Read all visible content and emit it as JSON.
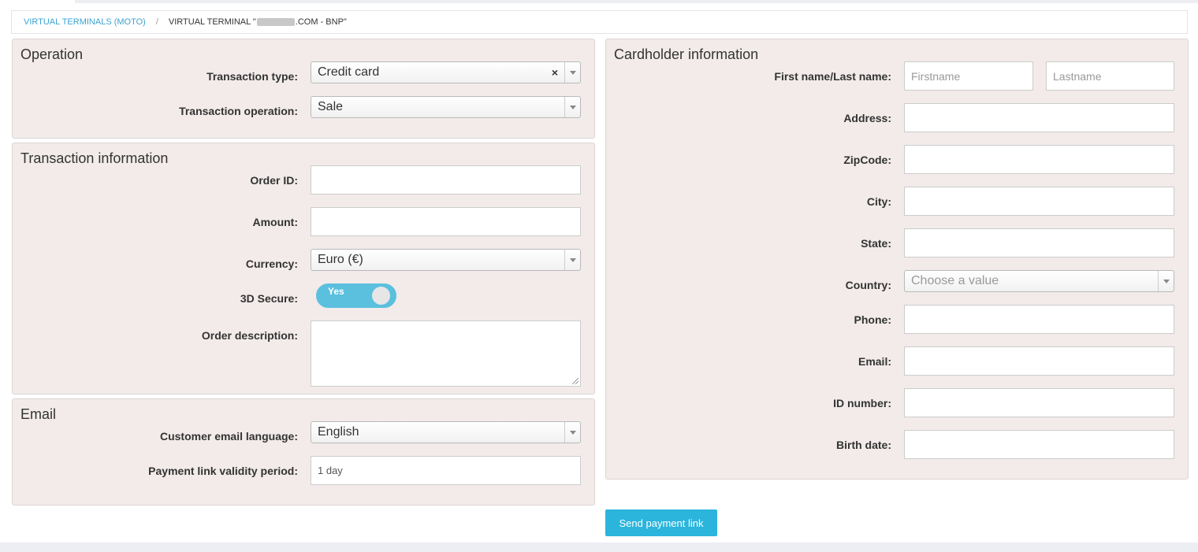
{
  "breadcrumb": {
    "link": "VIRTUAL TERMINALS (MOTO)",
    "separator": "/",
    "current_prefix": "VIRTUAL TERMINAL \"",
    "current_suffix": ".COM - BNP\""
  },
  "operation": {
    "title": "Operation",
    "transaction_type_label": "Transaction type:",
    "transaction_type_value": "Credit card",
    "transaction_type_clear": "×",
    "transaction_operation_label": "Transaction operation:",
    "transaction_operation_value": "Sale"
  },
  "transaction": {
    "title": "Transaction information",
    "order_id_label": "Order ID:",
    "order_id_value": "",
    "amount_label": "Amount:",
    "amount_value": "",
    "currency_label": "Currency:",
    "currency_value": "Euro (€)",
    "secure_label": "3D Secure:",
    "secure_toggle_text": "Yes",
    "description_label": "Order description:",
    "description_value": ""
  },
  "email": {
    "title": "Email",
    "language_label": "Customer email language:",
    "language_value": "English",
    "validity_label": "Payment link validity period:",
    "validity_value": "1 day"
  },
  "cardholder": {
    "title": "Cardholder information",
    "name_label": "First name/Last name:",
    "firstname_placeholder": "Firstname",
    "lastname_placeholder": "Lastname",
    "address_label": "Address:",
    "zipcode_label": "ZipCode:",
    "city_label": "City:",
    "state_label": "State:",
    "country_label": "Country:",
    "country_placeholder": "Choose a value",
    "phone_label": "Phone:",
    "email_label": "Email:",
    "id_label": "ID number:",
    "birth_label": "Birth date:"
  },
  "actions": {
    "send_label": "Send payment link"
  },
  "colors": {
    "panel_bg": "#f2ebea",
    "accent": "#2bb5dc",
    "link": "#3ba3d0"
  }
}
